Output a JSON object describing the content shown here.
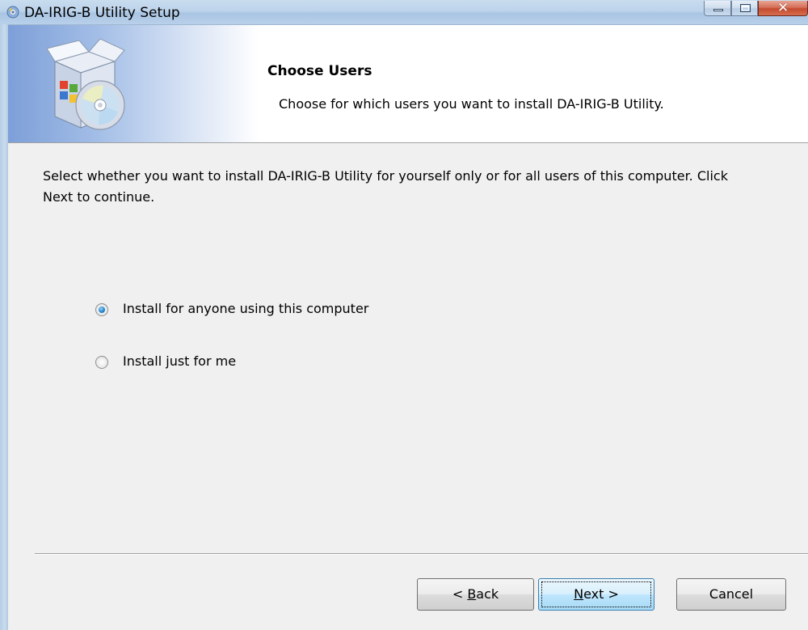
{
  "window": {
    "title": "DA-IRIG-B Utility Setup",
    "icon": "installer-disc-icon"
  },
  "header": {
    "title": "Choose Users",
    "subtitle": "Choose for which users you want to install DA-IRIG-B Utility.",
    "logo": "install-box-cd-icon"
  },
  "body": {
    "intro": "Select whether you want to install DA-IRIG-B Utility for yourself only or for all users of this computer. Click Next to continue.",
    "options": [
      {
        "label": "Install for anyone using this computer",
        "selected": true
      },
      {
        "label": "Install just for me",
        "selected": false
      }
    ]
  },
  "buttons": {
    "back": {
      "prefix": "< ",
      "accel": "B",
      "rest": "ack"
    },
    "next": {
      "accel": "N",
      "rest": "ext >"
    },
    "cancel": "Cancel"
  },
  "colors": {
    "header_gradient_start": "#7d9fd8",
    "selected_radio": "#2a8dd4",
    "close_button": "#c44a2f"
  }
}
